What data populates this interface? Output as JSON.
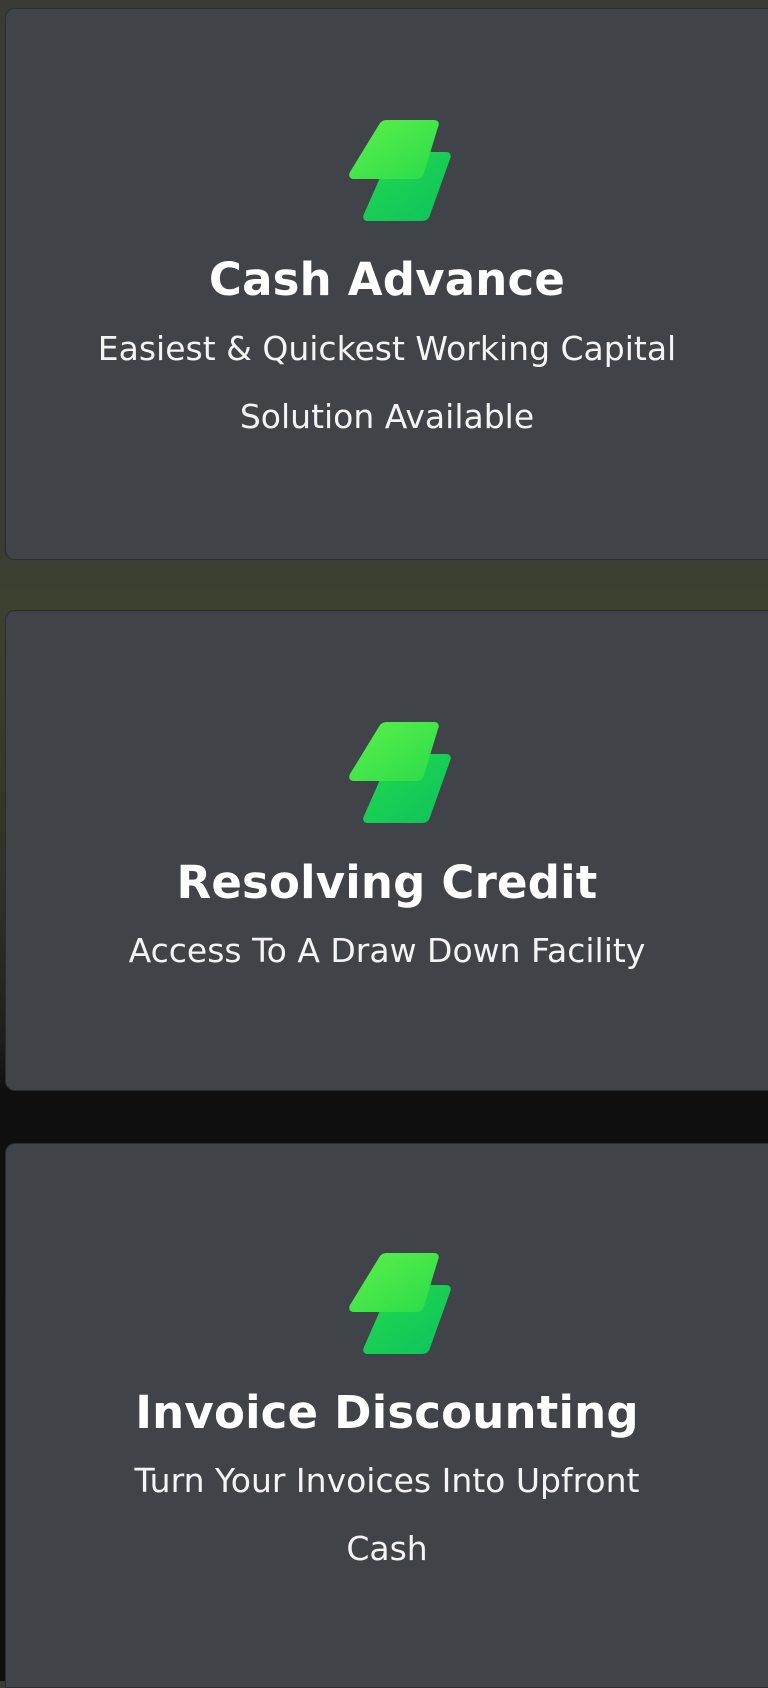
{
  "colors": {
    "card_background": "#404348",
    "logo_green_light": "#4be84a",
    "logo_green_dark": "#12c95a",
    "text": "#ffffff"
  },
  "products": [
    {
      "title": "Cash Advance",
      "description": "Easiest & Quickest Working Capital Solution Available",
      "icon": "lightning-leaf-icon"
    },
    {
      "title": "Resolving Credit",
      "description": "Access To A Draw Down Facility",
      "icon": "lightning-leaf-icon"
    },
    {
      "title": "Invoice Discounting",
      "description": "Turn Your Invoices Into Upfront Cash",
      "icon": "lightning-leaf-icon"
    }
  ]
}
